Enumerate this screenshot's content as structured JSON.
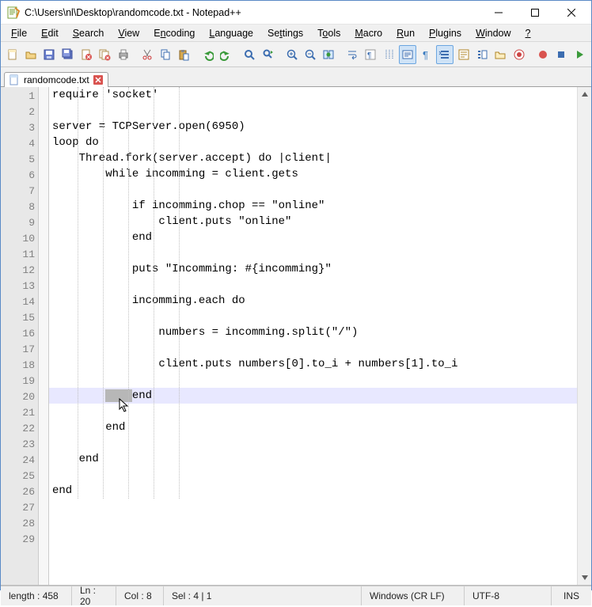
{
  "window": {
    "title": "C:\\Users\\nl\\Desktop\\randomcode.txt - Notepad++"
  },
  "menu": {
    "file": "File",
    "edit": "Edit",
    "search": "Search",
    "view": "View",
    "encoding": "Encoding",
    "language": "Language",
    "settings": "Settings",
    "tools": "Tools",
    "macro": "Macro",
    "run": "Run",
    "plugins": "Plugins",
    "window": "Window",
    "help": "?"
  },
  "tab": {
    "filename": "randomcode.txt"
  },
  "code": {
    "lines": [
      "require 'socket'",
      "",
      "server = TCPServer.open(6950)",
      "loop do",
      "    Thread.fork(server.accept) do |client|",
      "        while incomming = client.gets",
      "",
      "            if incomming.chop == \"online\"",
      "                client.puts \"online\"",
      "            end",
      "",
      "            puts \"Incomming: #{incomming}\"",
      "",
      "            incomming.each do",
      "",
      "                numbers = incomming.split(\"/\")",
      "",
      "                client.puts numbers[0].to_i + numbers[1].to_i",
      "",
      "            end",
      "",
      "        end",
      "",
      "    end",
      "",
      "end",
      "",
      "",
      ""
    ],
    "highlighted_line_index": 19,
    "selection": {
      "line_index": 19,
      "col_start": 8,
      "col_end": 12
    }
  },
  "status": {
    "length": "length : 458",
    "ln": "Ln : 20",
    "col": "Col : 8",
    "sel": "Sel : 4 | 1",
    "eol": "Windows (CR LF)",
    "encoding": "UTF-8",
    "mode": "INS"
  },
  "icons": {
    "app": "notepadpp-icon"
  }
}
